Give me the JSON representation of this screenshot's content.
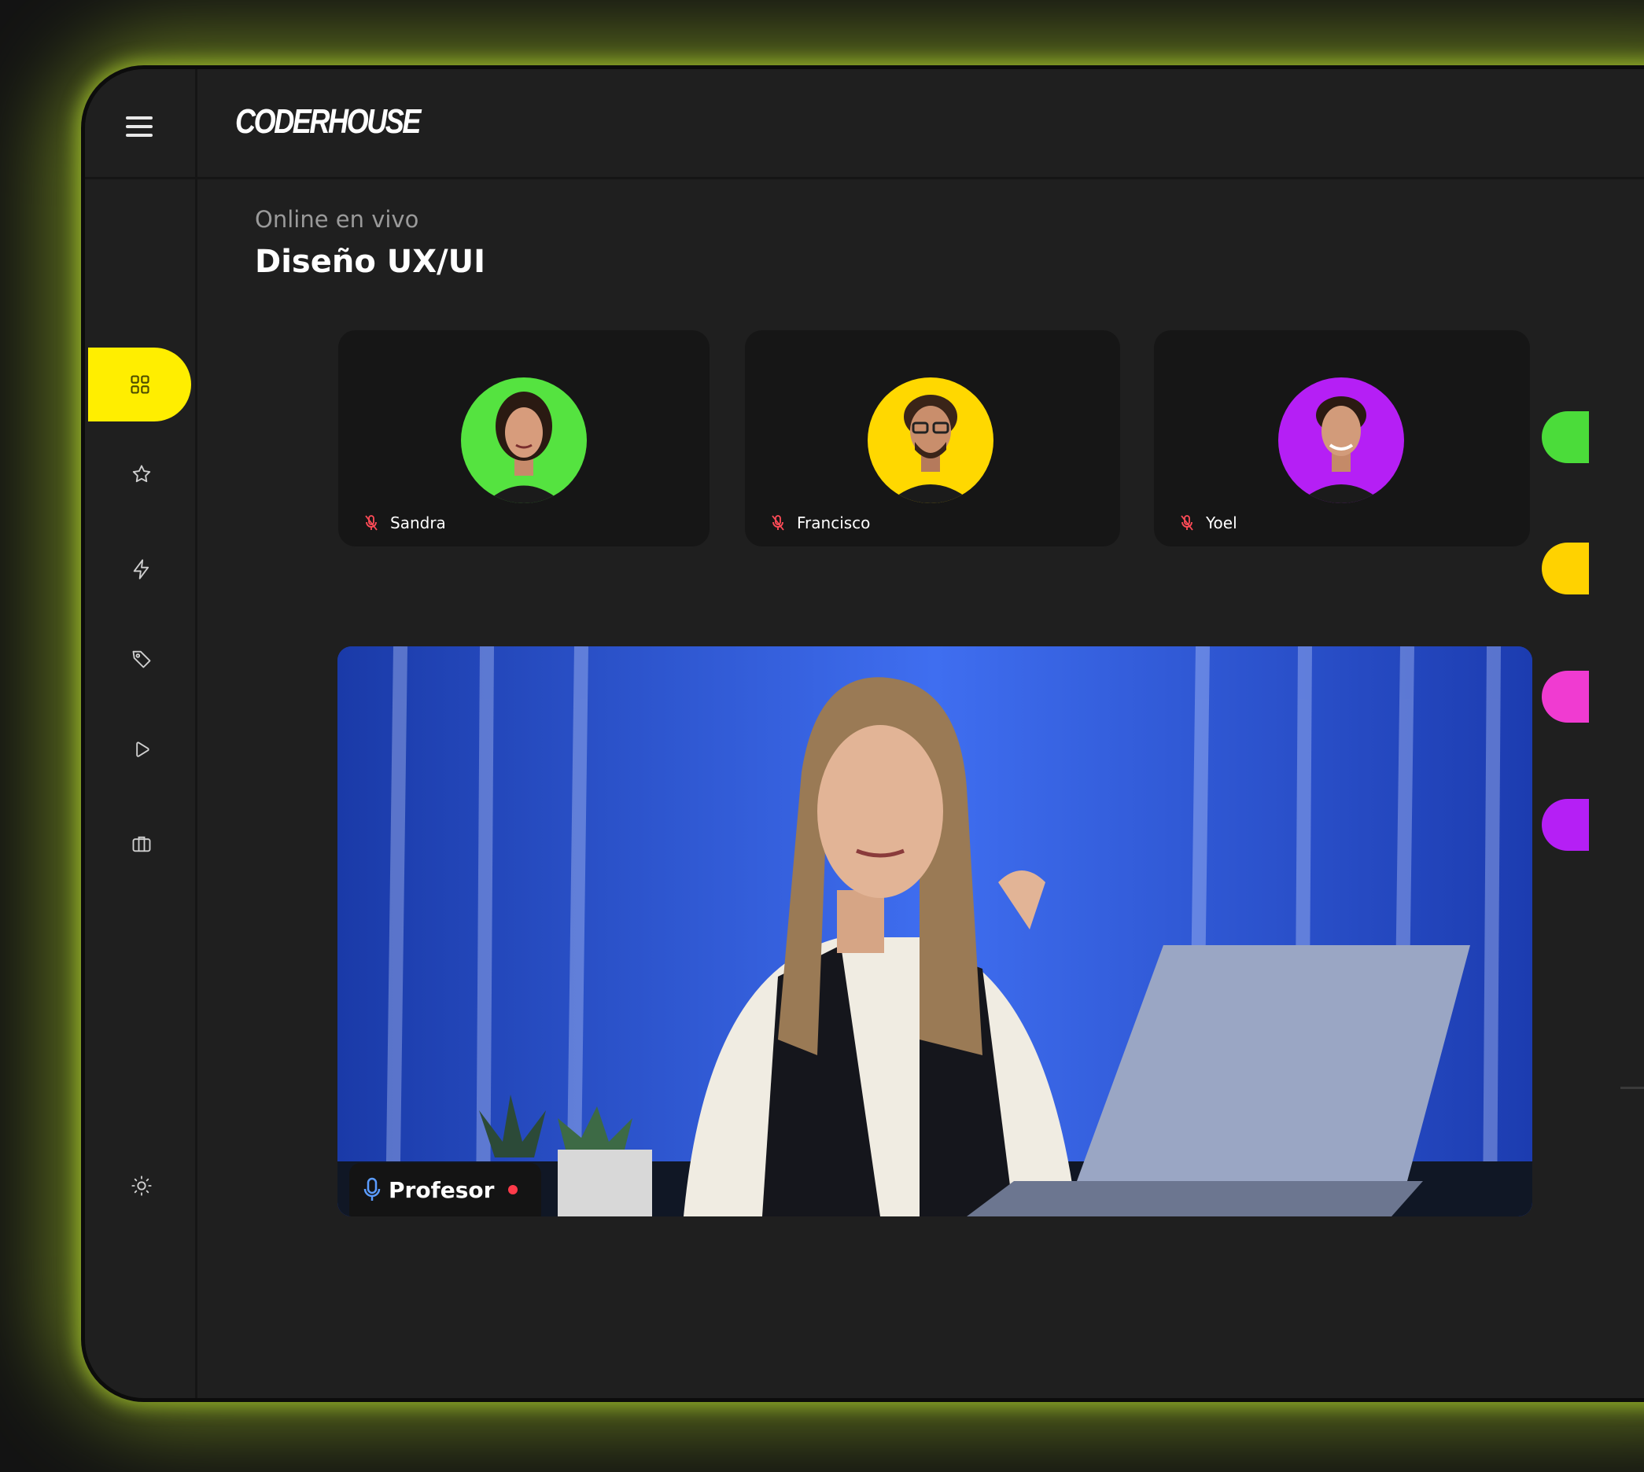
{
  "brand": {
    "logo_text": "CODERHOUSE"
  },
  "header": {
    "subtitle": "Online en vivo",
    "title": "Diseño UX/UI"
  },
  "sidebar": {
    "items": [
      {
        "icon": "grid-icon",
        "active": true
      },
      {
        "icon": "star-icon",
        "active": false
      },
      {
        "icon": "lightning-icon",
        "active": false
      },
      {
        "icon": "tag-icon",
        "active": false
      },
      {
        "icon": "play-icon",
        "active": false
      },
      {
        "icon": "briefcase-icon",
        "active": false
      },
      {
        "icon": "sun-icon",
        "active": false
      }
    ]
  },
  "participants": [
    {
      "name": "Sandra",
      "muted": true,
      "avatar_color": "#55e340"
    },
    {
      "name": "Francisco",
      "muted": true,
      "avatar_color": "#ffd800"
    },
    {
      "name": "Yoel",
      "muted": true,
      "avatar_color": "#b51ff5"
    }
  ],
  "stream": {
    "label": "Profesor",
    "mic_on": true,
    "live": true
  },
  "side_avatars": [
    "#4bdc3a",
    "#ffd200",
    "#f03bd1",
    "#b51ff5"
  ],
  "colors": {
    "accent": "#ffee00",
    "glow": "#b8e02a",
    "background": "#1f1f1f",
    "muted_mic": "#ff4b57",
    "mic_active": "#5b9cff"
  }
}
